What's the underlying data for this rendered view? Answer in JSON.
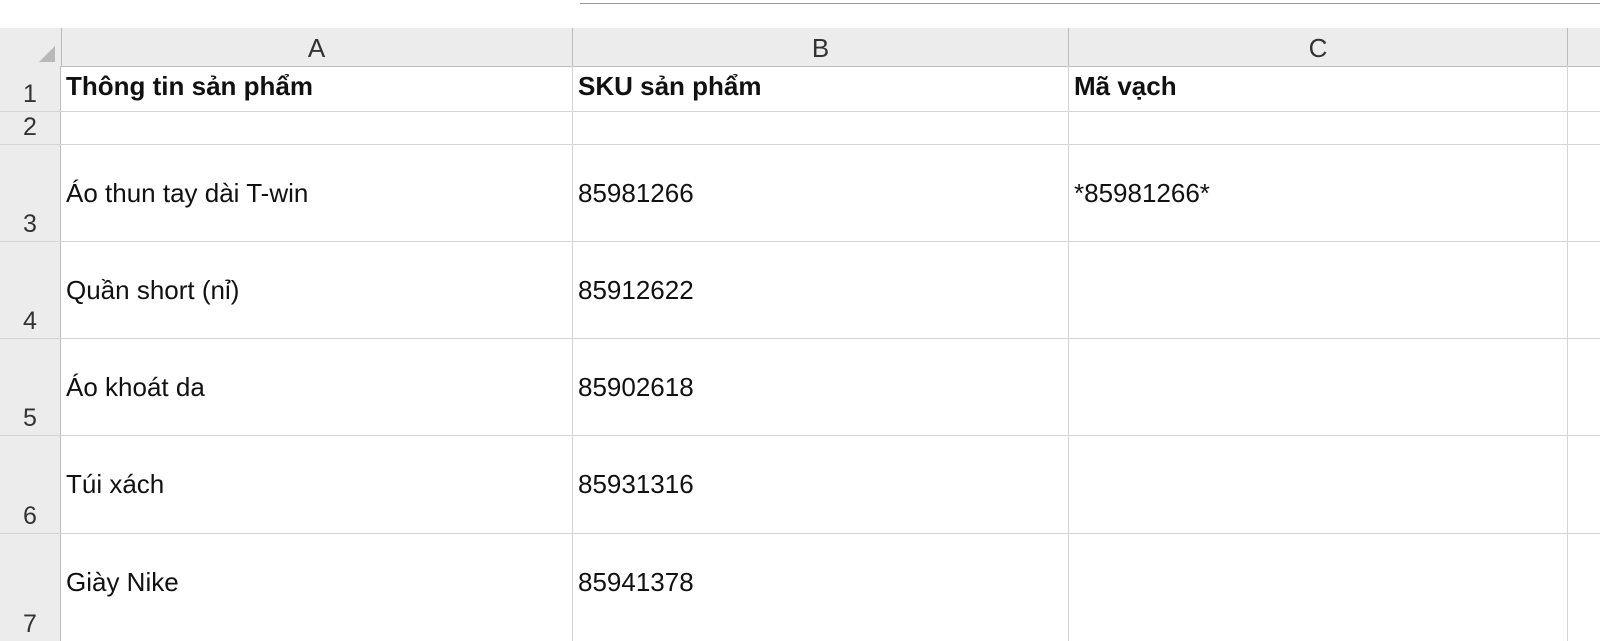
{
  "columns": [
    "A",
    "B",
    "C"
  ],
  "rows": [
    {
      "num": "1",
      "a": "Thông tin sản phẩm",
      "b": "SKU sản phẩm",
      "c": "Mã vạch"
    },
    {
      "num": "2",
      "a": "",
      "b": "",
      "c": ""
    },
    {
      "num": "3",
      "a": "Áo thun tay dài T-win",
      "b": "85981266",
      "c": "*85981266*"
    },
    {
      "num": "4",
      "a": "Quần short (nỉ)",
      "b": "85912622",
      "c": ""
    },
    {
      "num": "5",
      "a": "Áo khoát da",
      "b": "85902618",
      "c": ""
    },
    {
      "num": "6",
      "a": "Túi xách",
      "b": "85931316",
      "c": ""
    },
    {
      "num": "7",
      "a": "Giày Nike",
      "b": "85941378",
      "c": ""
    }
  ]
}
